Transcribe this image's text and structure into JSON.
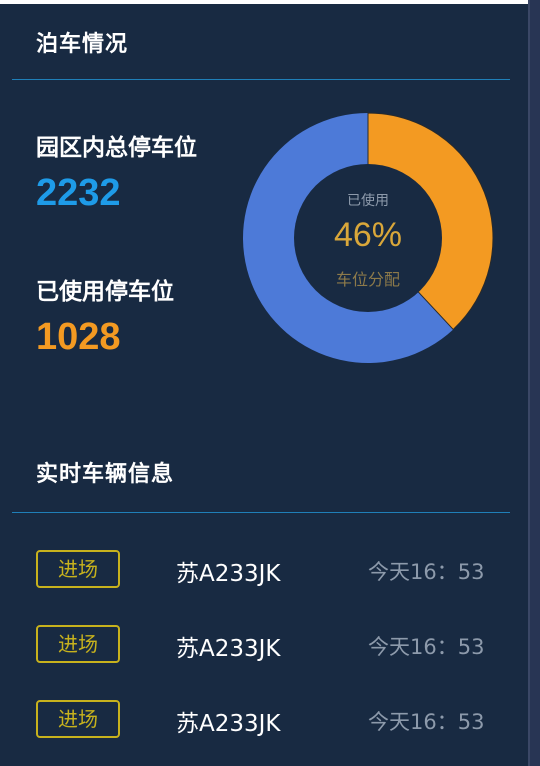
{
  "parking": {
    "title": "泊车情况",
    "total_label": "园区内总停车位",
    "total_value": "2232",
    "used_label": "已使用停车位",
    "used_value": "1028",
    "donut": {
      "center_label": "已使用",
      "percent_text": "46%",
      "sub_label": "车位分配",
      "used_fraction": 0.3806,
      "colors": {
        "used": "#f39a22",
        "free": "#4d7ad8",
        "hole": "#182a42"
      }
    }
  },
  "realtime": {
    "title": "实时车辆信息",
    "rows": [
      {
        "status": "进场",
        "plate": "苏A233JK",
        "time": "今天16：53"
      },
      {
        "status": "进场",
        "plate": "苏A233JK",
        "time": "今天16：53"
      },
      {
        "status": "进场",
        "plate": "苏A233JK",
        "time": "今天16：53"
      }
    ]
  },
  "colors": {
    "background": "#182a42",
    "divider": "#1f7fb8",
    "total_value": "#1e9be8",
    "used_value": "#f39a22",
    "badge": "#c7b21d"
  }
}
